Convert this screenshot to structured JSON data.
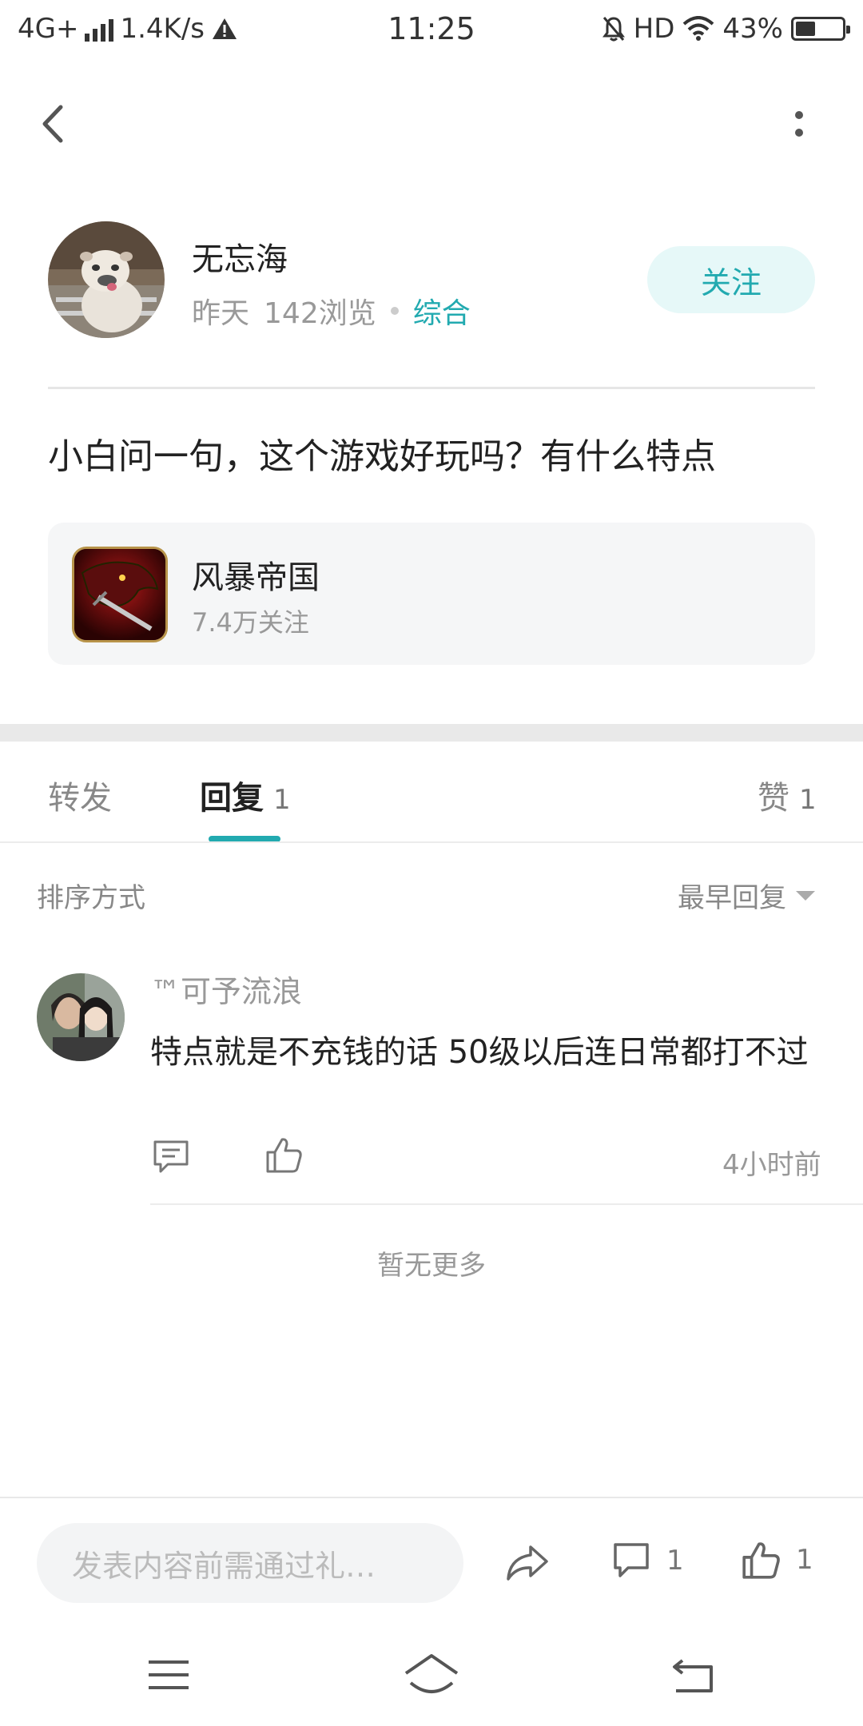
{
  "status_bar": {
    "network": "4G+",
    "speed": "1.4K/s",
    "time": "11:25",
    "hd": "HD",
    "battery": "43%",
    "battery_level": 0.43
  },
  "author": {
    "name": "无忘海",
    "time": "昨天",
    "views": "142浏览",
    "category": "综合",
    "follow_label": "关注"
  },
  "post": {
    "text": "小白问一句，这个游戏好玩吗？有什么特点"
  },
  "game": {
    "name": "风暴帝国",
    "follows": "7.4万关注"
  },
  "tabs": [
    {
      "label": "转发",
      "count": ""
    },
    {
      "label": "回复",
      "count": "1"
    },
    {
      "label": "赞",
      "count": "1"
    }
  ],
  "sort": {
    "label": "排序方式",
    "value": "最早回复"
  },
  "reply": {
    "user": "™可予流浪",
    "text": "特点就是不充钱的话  50级以后连日常都打不过",
    "time": "4小时前"
  },
  "no_more": "暂无更多",
  "bottom_bar": {
    "placeholder": "发表内容前需通过礼…",
    "comment_count": "1",
    "like_count": "1"
  },
  "colors": {
    "accent": "#22aab0",
    "follow_bg": "#e6f8f8"
  }
}
